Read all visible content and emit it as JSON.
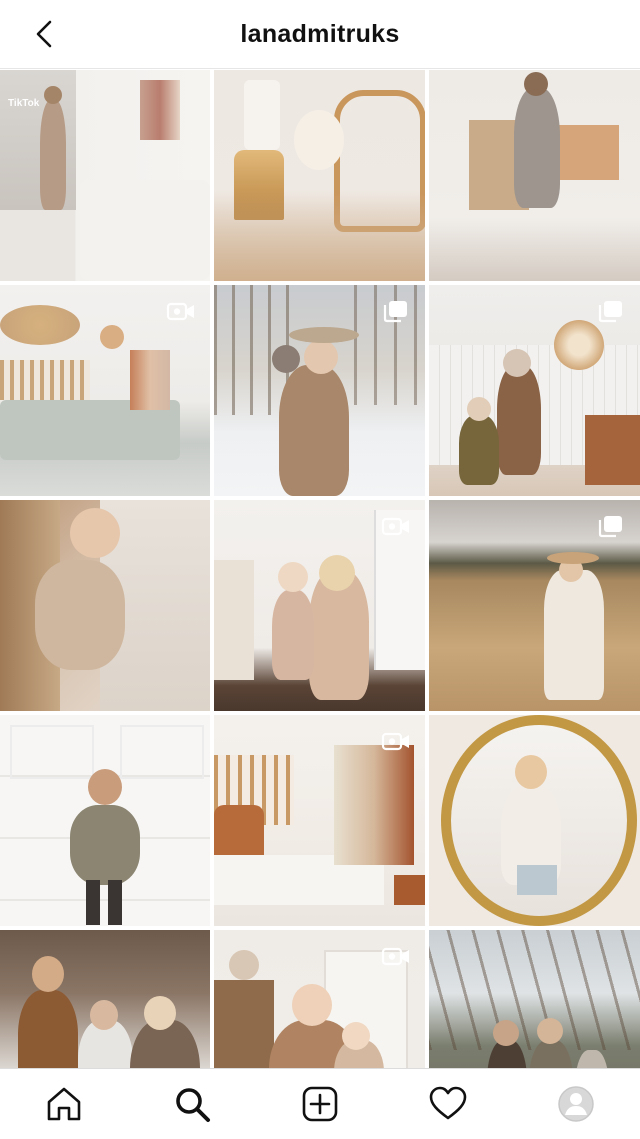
{
  "header": {
    "title": "lanadmitruks"
  },
  "posts": [
    {
      "overlay": "TikTok",
      "badge": null
    },
    {
      "badge": null
    },
    {
      "badge": null
    },
    {
      "badge": "video"
    },
    {
      "badge": "carousel"
    },
    {
      "badge": "carousel"
    },
    {
      "badge": null
    },
    {
      "badge": "video"
    },
    {
      "badge": "carousel"
    },
    {
      "badge": null
    },
    {
      "badge": "video"
    },
    {
      "badge": null
    },
    {
      "badge": null
    },
    {
      "badge": "video"
    },
    {
      "badge": null
    }
  ],
  "nav": [
    "home-icon",
    "search-icon",
    "new-post-icon",
    "activity-heart-icon",
    "profile-avatar-icon"
  ]
}
